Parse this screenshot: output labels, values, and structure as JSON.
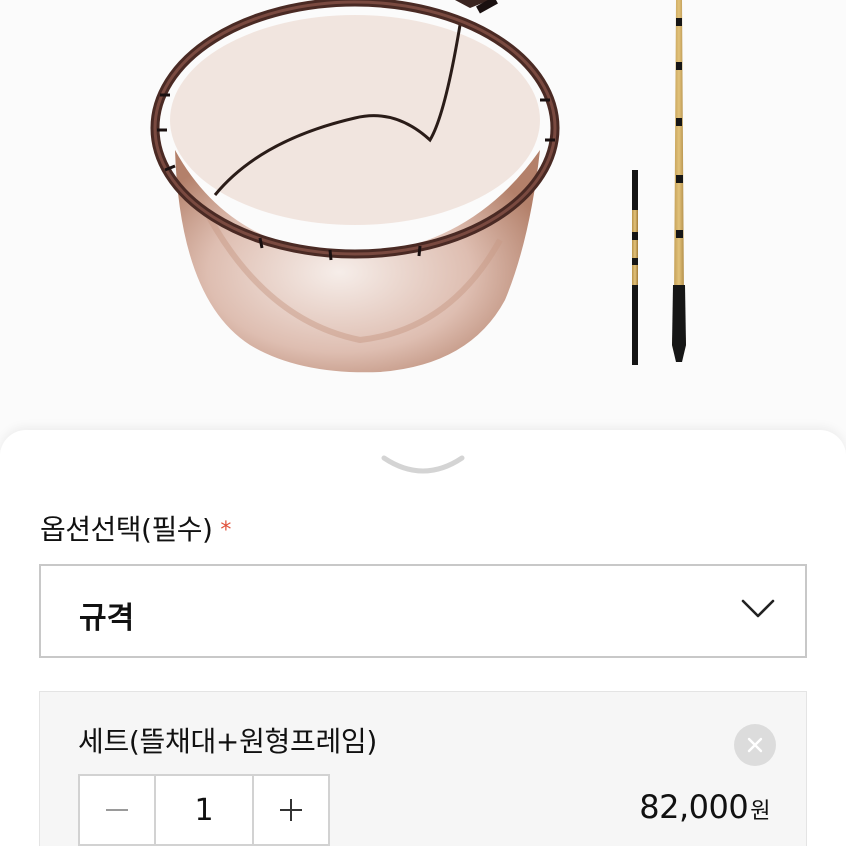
{
  "option_section": {
    "heading": "옵션선택(필수)",
    "required_mark": "*",
    "select_label": "규격"
  },
  "selected_item": {
    "name": "세트(뜰채대+원형프레임)",
    "quantity": "1",
    "price": "82,000",
    "currency": "원"
  },
  "icons": {
    "sheet_handle": "chevron-down-icon",
    "select_arrow": "chevron-down-icon",
    "remove": "close-icon",
    "decrease": "minus-icon",
    "increase": "plus-icon"
  },
  "colors": {
    "required_star": "#e0503a",
    "border": "#c8c8c8",
    "item_background": "#f6f6f6"
  }
}
